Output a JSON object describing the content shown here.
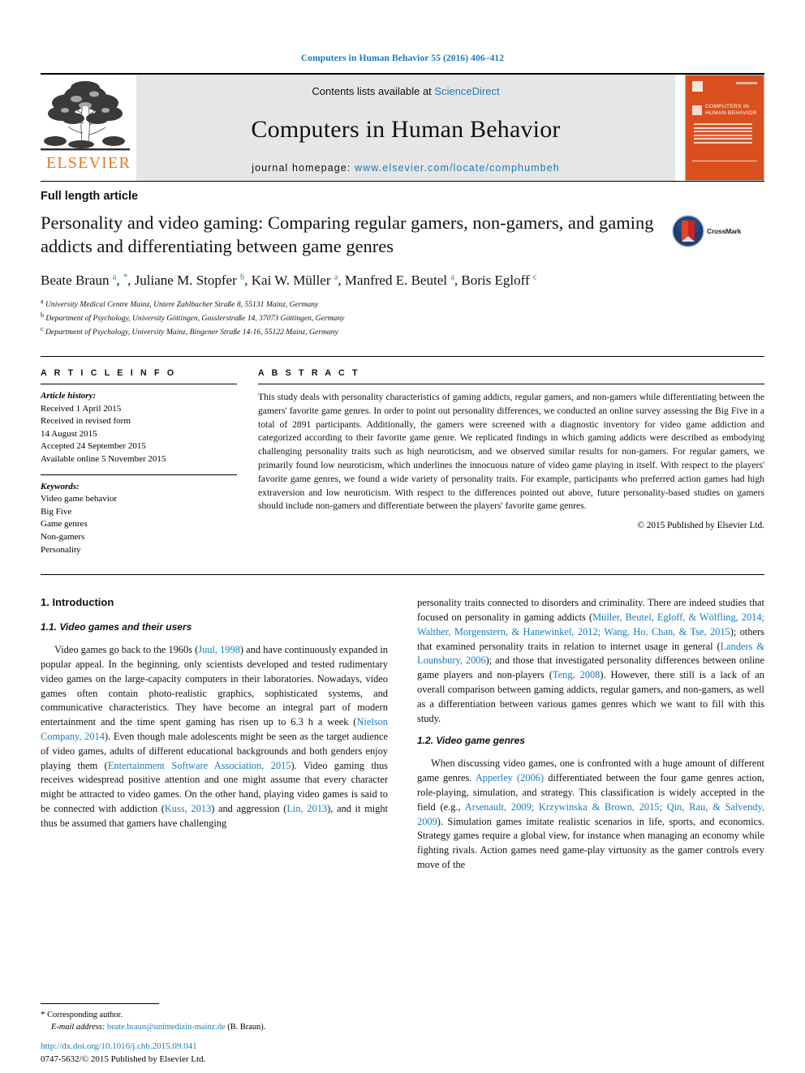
{
  "running_head": "Computers in Human Behavior 55 (2016) 406–412",
  "masthead": {
    "contents_prefix": "Contents lists available at ",
    "sciencedirect": "ScienceDirect",
    "journal_title": "Computers in Human Behavior",
    "homepage_label": "journal homepage: ",
    "homepage_url": "www.elsevier.com/locate/comphumbeh",
    "publisher_wordmark": "ELSEVIER",
    "cover_title_line1": "COMPUTERS IN",
    "cover_title_line2": "HUMAN BEHAVIOR",
    "accent_color": "#1a7bb9",
    "cover_color": "#d9501e",
    "elsevier_orange": "#E87722"
  },
  "article": {
    "type": "Full length article",
    "title": "Personality and video gaming: Comparing regular gamers, non-gamers, and gaming addicts and differentiating between game genres",
    "crossmark_label": "CrossMark",
    "authors_html": "Beate Braun <sup>a</sup>, <sup>*</sup>, Juliane M. Stopfer <sup>b</sup>, Kai W. Müller <sup>a</sup>, Manfred E. Beutel <sup>a</sup>, Boris Egloff <sup>c</sup>",
    "affiliations": [
      {
        "mark": "a",
        "text": "University Medical Centre Mainz, Untere Zahlbacher Straße 8, 55131 Mainz, Germany"
      },
      {
        "mark": "b",
        "text": "Department of Psychology, University Göttingen, Gosslerstraße 14, 37073 Göttingen, Germany"
      },
      {
        "mark": "c",
        "text": "Department of Psychology, University Mainz, Bingener Straße 14-16, 55122 Mainz, Germany"
      }
    ]
  },
  "article_info": {
    "heading": "A R T I C L E  I N F O",
    "history_label": "Article history:",
    "history": [
      "Received 1 April 2015",
      "Received in revised form",
      "14 August 2015",
      "Accepted 24 September 2015",
      "Available online 5 November 2015"
    ],
    "keywords_label": "Keywords:",
    "keywords": [
      "Video game behavior",
      "Big Five",
      "Game genres",
      "Non-gamers",
      "Personality"
    ]
  },
  "abstract": {
    "heading": "A B S T R A C T",
    "text": "This study deals with personality characteristics of gaming addicts, regular gamers, and non-gamers while differentiating between the gamers' favorite game genres. In order to point out personality differences, we conducted an online survey assessing the Big Five in a total of 2891 participants. Additionally, the gamers were screened with a diagnostic inventory for video game addiction and categorized according to their favorite game genre. We replicated findings in which gaming addicts were described as embodying challenging personality traits such as high neuroticism, and we observed similar results for non-gamers. For regular gamers, we primarily found low neuroticism, which underlines the innocuous nature of video game playing in itself. With respect to the players' favorite game genres, we found a wide variety of personality traits. For example, participants who preferred action games had high extraversion and low neuroticism. With respect to the differences pointed out above, future personality-based studies on gamers should include non-gamers and differentiate between the players' favorite game genres.",
    "copyright": "© 2015 Published by Elsevier Ltd."
  },
  "body": {
    "section1_heading": "1. Introduction",
    "section11_heading": "1.1. Video games and their users",
    "section12_heading": "1.2. Video game genres",
    "para_1_1_part1": "Video games go back to the 1960s (",
    "cite_juul": "Juul, 1998",
    "para_1_1_part2": ") and have continuously expanded in popular appeal. In the beginning, only scientists developed and tested rudimentary video games on the large-capacity computers in their laboratories. Nowadays, video games often contain photo-realistic graphics, sophisticated systems, and communicative characteristics. They have become an integral part of modern entertainment and the time spent gaming has risen up to 6.3 h a week (",
    "cite_nielson": "Nielson Company, 2014",
    "para_1_1_part3": "). Even though male adolescents might be seen as the target audience of video games, adults of different educational backgrounds and both genders enjoy playing them (",
    "cite_esa": "Entertainment Software Association, 2015",
    "para_1_1_part4": "). Video gaming thus receives widespread positive attention and one might assume that every character might be attracted to video games. On the other hand, playing video games is said to be connected with addiction (",
    "cite_kuss": "Kuss, 2013",
    "para_1_1_part5": ") and aggression (",
    "cite_lin": "Lin, 2013",
    "para_1_1_part6": "), and it might thus be assumed that gamers have challenging",
    "para_r1_part1": "personality traits connected to disorders and criminality. There are indeed studies that focused on personality in gaming addicts (",
    "cite_mueller": "Müller, Beutel, Egloff, & Wölfling, 2014; Walther, Morgenstern, & Hanewinkel, 2012; Wang, Ho, Chan, & Tse, 2015",
    "para_r1_part2": "); others that examined personality traits in relation to internet usage in general (",
    "cite_landers": "Landers & Lounsbury, 2006",
    "para_r1_part3": "); and those that investigated personality differences between online game players and non-players (",
    "cite_teng": "Teng, 2008",
    "para_r1_part4": "). However, there still is a lack of an overall comparison between gaming addicts, regular gamers, and non-gamers, as well as a differentiation between various games genres which we want to fill with this study.",
    "para_12_part1": "When discussing video games, one is confronted with a huge amount of different game genres. ",
    "cite_apperley": "Apperley (2006)",
    "para_12_part2": " differentiated between the four game genres action, role-playing, simulation, and strategy. This classification is widely accepted in the field (e.g., ",
    "cite_arsenault": "Arsenault, 2009; Krzywinska & Brown, 2015; Qin, Rau, & Salvendy, 2009",
    "para_12_part3": "). Simulation games imitate realistic scenarios in life, sports, and economics. Strategy games require a global view, for instance when managing an economy while fighting rivals. Action games need game-play virtuosity as the gamer controls every move of the"
  },
  "footer": {
    "corresponding_marker": "*",
    "corresponding_label": "Corresponding author.",
    "email_label": "E-mail address:",
    "email": "beate.braun@unimedizin-mainz.de",
    "email_owner": "(B. Braun).",
    "doi": "http://dx.doi.org/10.1016/j.chb.2015.09.041",
    "issn_line": "0747-5632/© 2015 Published by Elsevier Ltd."
  }
}
